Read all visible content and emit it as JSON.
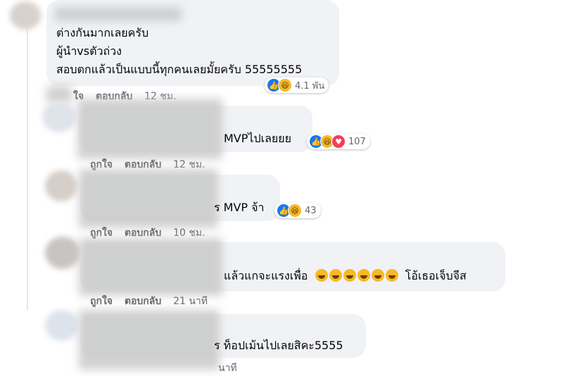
{
  "comments": [
    {
      "lines": [
        "ต่างกันมากเลยครับ",
        "ผู้นำvsตัวถ่วง",
        "สอบตกแล้วเป็นแบบนี้ทุกคนเลยมั้ยครับ 55555555"
      ],
      "reaction_count": "4.1 พัน",
      "actions": {
        "like": "ใจ",
        "reply": "ตอบกลับ",
        "time": "12 ชม."
      }
    },
    {
      "text": "MVPไปเลยยย",
      "reaction_count": "107",
      "actions": {
        "like": "ถูกใจ",
        "reply": "ตอบกลับ",
        "time": "12 ชม."
      }
    },
    {
      "text": "ร MVP จ้า",
      "reaction_count": "43",
      "actions": {
        "like": "ถูกใจ",
        "reply": "ตอบกลับ",
        "time": "10 ชม."
      }
    },
    {
      "text": "แล้วแกจะแรงเพื่อ",
      "text_after": "โอ้เธอเจ็บจีส",
      "actions": {
        "like": "ถูกใจ",
        "reply": "ตอบกลับ",
        "time": "21 นาที"
      }
    },
    {
      "text": "ร ท็อปเม้นไปเลยสิคะ5555",
      "actions": {
        "time": "นาที"
      }
    }
  ],
  "icons": {
    "like": "thumbs-up-icon",
    "haha": "laughing-face-icon",
    "love": "heart-icon",
    "emoji": "rolling-laughing-emoji-icon"
  },
  "colors": {
    "bubble": "#f0f2f5",
    "like": "#1877f2",
    "haha": "#f7b928",
    "love": "#f33e58",
    "meta_text": "#65676b"
  }
}
